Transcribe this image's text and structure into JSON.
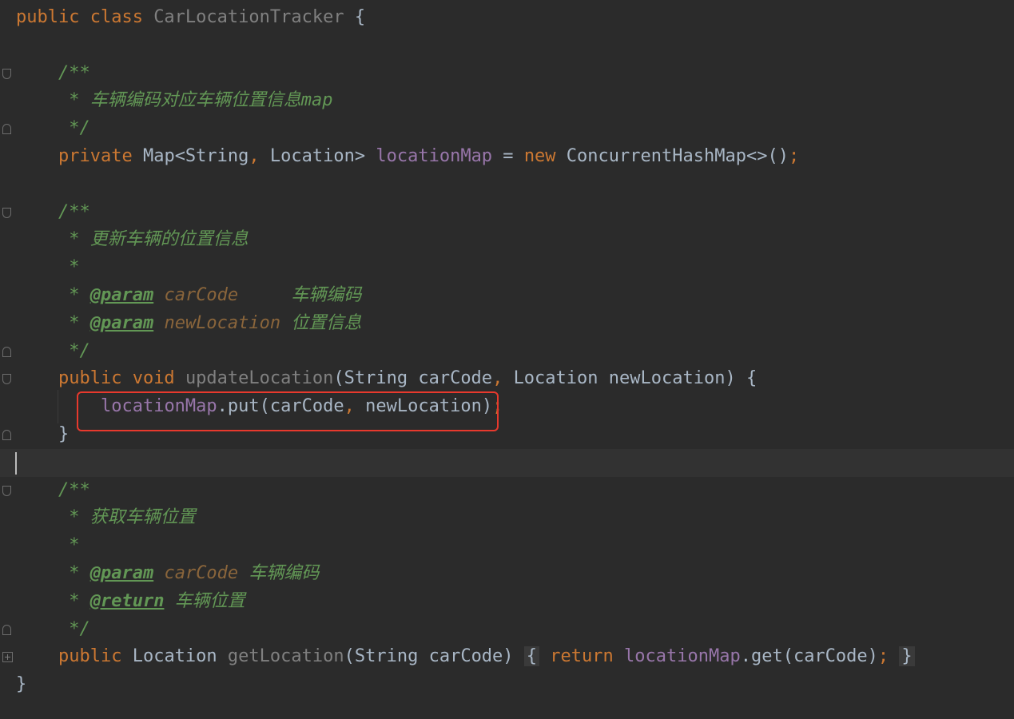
{
  "editor": {
    "lines": [
      {
        "segments": [
          {
            "t": "public class ",
            "c": "kw"
          },
          {
            "t": "CarLocationTracker",
            "c": "dim"
          },
          {
            "t": " {",
            "c": "cls"
          }
        ]
      },
      {
        "segments": []
      },
      {
        "segments": [
          {
            "t": "    /**",
            "c": "doc"
          }
        ]
      },
      {
        "segments": [
          {
            "t": "     * 车辆编码对应车辆位置信息map",
            "c": "doc"
          }
        ]
      },
      {
        "segments": [
          {
            "t": "     */",
            "c": "doc"
          }
        ]
      },
      {
        "segments": [
          {
            "t": "    ",
            "c": "cls"
          },
          {
            "t": "private ",
            "c": "kw"
          },
          {
            "t": "Map<String",
            "c": "cls"
          },
          {
            "t": ", ",
            "c": "kw"
          },
          {
            "t": "Location> ",
            "c": "cls"
          },
          {
            "t": "locationMap",
            "c": "field"
          },
          {
            "t": " = ",
            "c": "cls"
          },
          {
            "t": "new ",
            "c": "kw"
          },
          {
            "t": "ConcurrentHashMap<>()",
            "c": "cls"
          },
          {
            "t": ";",
            "c": "kw"
          }
        ]
      },
      {
        "segments": []
      },
      {
        "segments": [
          {
            "t": "    /**",
            "c": "doc"
          }
        ]
      },
      {
        "segments": [
          {
            "t": "     * 更新车辆的位置信息",
            "c": "doc"
          }
        ]
      },
      {
        "segments": [
          {
            "t": "     *",
            "c": "doc"
          }
        ]
      },
      {
        "segments": [
          {
            "t": "     * ",
            "c": "doc"
          },
          {
            "t": "@param",
            "c": "tag"
          },
          {
            "t": " ",
            "c": "doc"
          },
          {
            "t": "carCode",
            "c": "pname"
          },
          {
            "t": "     车辆编码",
            "c": "doc"
          }
        ]
      },
      {
        "segments": [
          {
            "t": "     * ",
            "c": "doc"
          },
          {
            "t": "@param",
            "c": "tag"
          },
          {
            "t": " ",
            "c": "doc"
          },
          {
            "t": "newLocation",
            "c": "pname"
          },
          {
            "t": " 位置信息",
            "c": "doc"
          }
        ]
      },
      {
        "segments": [
          {
            "t": "     */",
            "c": "doc"
          }
        ]
      },
      {
        "segments": [
          {
            "t": "    ",
            "c": "cls"
          },
          {
            "t": "public void ",
            "c": "kw"
          },
          {
            "t": "updateLocation",
            "c": "methoddim"
          },
          {
            "t": "(String carCode",
            "c": "cls"
          },
          {
            "t": ", ",
            "c": "kw"
          },
          {
            "t": "Location newLocation) {",
            "c": "cls"
          }
        ]
      },
      {
        "segments": [
          {
            "t": "        ",
            "c": "cls"
          },
          {
            "t": "locationMap",
            "c": "field"
          },
          {
            "t": ".put(carCode",
            "c": "cls"
          },
          {
            "t": ", ",
            "c": "kw"
          },
          {
            "t": "newLocation)",
            "c": "cls"
          },
          {
            "t": ";",
            "c": "kw"
          }
        ]
      },
      {
        "segments": [
          {
            "t": "    }",
            "c": "cls"
          }
        ]
      },
      {
        "segments": []
      },
      {
        "segments": [
          {
            "t": "    /**",
            "c": "doc"
          }
        ]
      },
      {
        "segments": [
          {
            "t": "     * 获取车辆位置",
            "c": "doc"
          }
        ]
      },
      {
        "segments": [
          {
            "t": "     *",
            "c": "doc"
          }
        ]
      },
      {
        "segments": [
          {
            "t": "     * ",
            "c": "doc"
          },
          {
            "t": "@param",
            "c": "tag"
          },
          {
            "t": " ",
            "c": "doc"
          },
          {
            "t": "carCode",
            "c": "pname"
          },
          {
            "t": " 车辆编码",
            "c": "doc"
          }
        ]
      },
      {
        "segments": [
          {
            "t": "     * ",
            "c": "doc"
          },
          {
            "t": "@return",
            "c": "tag"
          },
          {
            "t": " 车辆位置",
            "c": "doc"
          }
        ]
      },
      {
        "segments": [
          {
            "t": "     */",
            "c": "doc"
          }
        ]
      },
      {
        "segments": [
          {
            "t": "    ",
            "c": "cls"
          },
          {
            "t": "public ",
            "c": "kw"
          },
          {
            "t": "Location ",
            "c": "cls"
          },
          {
            "t": "getLocation",
            "c": "methoddim"
          },
          {
            "t": "(String carCode) ",
            "c": "cls"
          },
          {
            "t": "{",
            "c": "fold-bg"
          },
          {
            "t": " ",
            "c": "cls"
          },
          {
            "t": "return ",
            "c": "kw"
          },
          {
            "t": "locationMap",
            "c": "field"
          },
          {
            "t": ".get(carCode)",
            "c": "cls"
          },
          {
            "t": ";",
            "c": "kw"
          },
          {
            "t": " ",
            "c": "cls"
          },
          {
            "t": "}",
            "c": "fold-bg"
          }
        ]
      },
      {
        "segments": [
          {
            "t": "}",
            "c": "cls"
          }
        ]
      }
    ],
    "current_line_index": 16,
    "highlighted_line_index": 14
  },
  "colors": {
    "background": "#2b2b2b",
    "keyword": "#cc7832",
    "field": "#9876aa",
    "doc_comment": "#629755",
    "highlight_box": "#e8392d"
  }
}
